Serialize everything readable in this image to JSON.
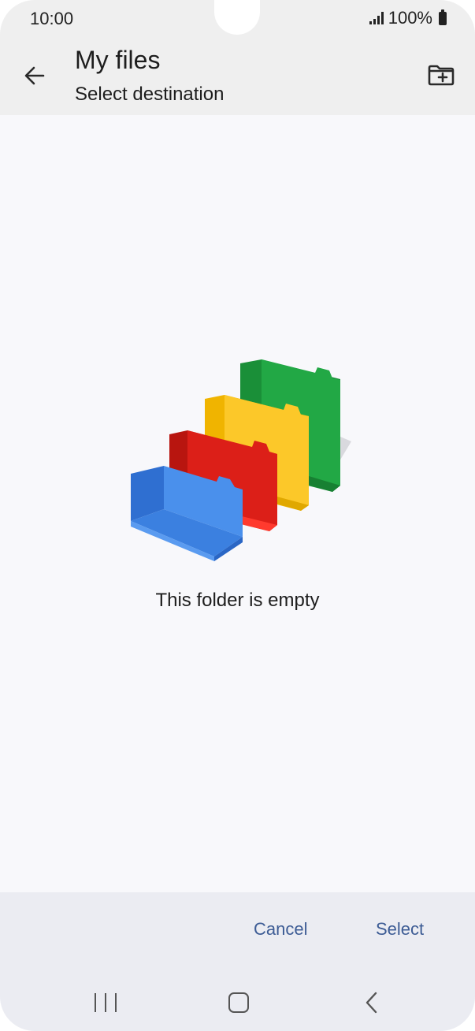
{
  "status": {
    "time": "10:00",
    "battery": "100%"
  },
  "appbar": {
    "title": "My files",
    "subtitle": "Select destination"
  },
  "content": {
    "empty_message": "This folder is empty"
  },
  "actions": {
    "cancel_label": "Cancel",
    "select_label": "Select"
  },
  "colors": {
    "accent_text": "#3d5c95",
    "folder_green": "#1e9e3e",
    "folder_yellow": "#f7c51e",
    "folder_red": "#d21a14",
    "folder_blue": "#3c82e6"
  }
}
